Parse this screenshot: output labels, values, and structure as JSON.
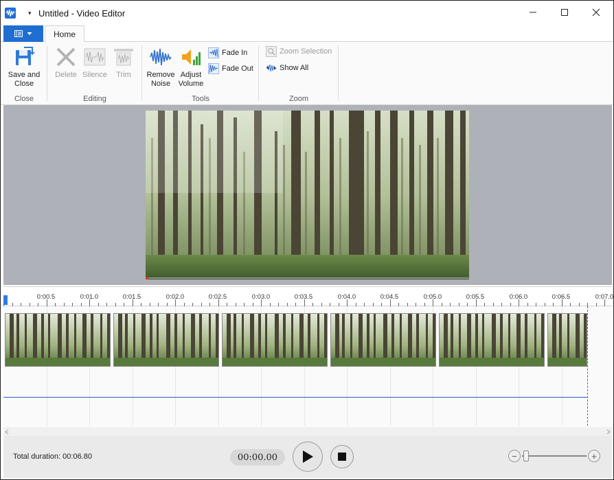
{
  "window": {
    "title": "Untitled - Video Editor",
    "quick_access_arrow": "▾"
  },
  "ribbon": {
    "tabs": [
      {
        "label": "Home"
      }
    ],
    "groups": {
      "close": {
        "label": "Close",
        "save_close": "Save and\nClose"
      },
      "editing": {
        "label": "Editing",
        "delete": "Delete",
        "silence": "Silence",
        "trim": "Trim"
      },
      "tools": {
        "label": "Tools",
        "remove_noise": "Remove\nNoise",
        "adjust_volume": "Adjust\nVolume",
        "fade_in": "Fade In",
        "fade_out": "Fade Out"
      },
      "zoom": {
        "label": "Zoom",
        "zoom_selection": "Zoom Selection",
        "show_all": "Show All"
      }
    }
  },
  "timeline": {
    "ruler_labels": [
      "0:00.5",
      "0:01.0",
      "0:01.5",
      "0:02.0",
      "0:02.5",
      "0:03.0",
      "0:03.5",
      "0:04.0",
      "0:04.5",
      "0:05.0",
      "0:05.5",
      "0:06.0",
      "0:06.5",
      "0:07.0"
    ],
    "thumbnail_count": 6
  },
  "playback": {
    "total_duration": "Total duration: 00:06.80",
    "timecode": "00:00.00",
    "zoom_minus": "−",
    "zoom_plus": "+"
  },
  "colors": {
    "accent": "#1e6fd1",
    "audio_line": "#2f5cc4",
    "preview_bg": "#aeb1b7"
  }
}
